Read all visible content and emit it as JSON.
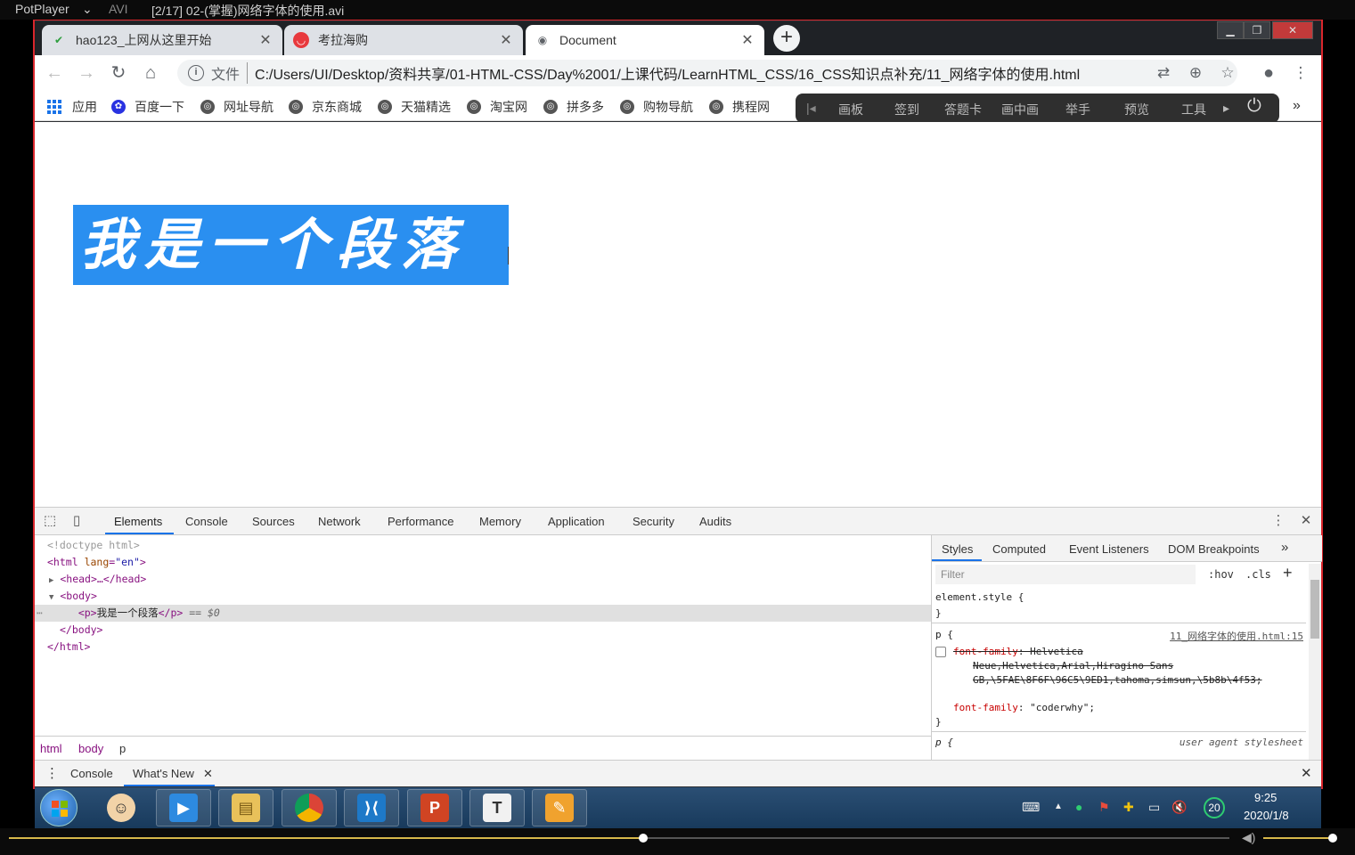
{
  "player": {
    "app": "PotPlayer",
    "format": "AVI",
    "title": "[2/17] 02-(掌握)网络字体的使用.avi",
    "seek_progress": 0.52,
    "volume": 0.95
  },
  "tabs": [
    {
      "label": "hao123_上网从这里开始",
      "icon": "hao123-icon"
    },
    {
      "label": "考拉海购",
      "icon": "kaola-icon"
    },
    {
      "label": "Document",
      "icon": "globe-icon",
      "active": true
    }
  ],
  "toolbar": {
    "file_label": "文件",
    "url": "C:/Users/UI/Desktop/资料共享/01-HTML-CSS/Day%2001/上课代码/LearnHTML_CSS/16_CSS知识点补充/11_网络字体的使用.html"
  },
  "bookmarks": [
    "应用",
    "百度一下",
    "网址导航",
    "京东商城",
    "天猫精选",
    "淘宝网",
    "拼多多",
    "购物导航",
    "携程网"
  ],
  "floatbar": [
    "画板",
    "签到",
    "答题卡",
    "画中画",
    "举手",
    "预览",
    "工具"
  ],
  "page": {
    "paragraph": "我是一个段落"
  },
  "devtools": {
    "tabs": [
      "Elements",
      "Console",
      "Sources",
      "Network",
      "Performance",
      "Memory",
      "Application",
      "Security",
      "Audits"
    ],
    "dom": {
      "doctype": "<!doctype html>",
      "html_open": "<html",
      "html_attr": "lang",
      "html_attr_val": "\"en\"",
      "head": "<head>…</head>",
      "body_open": "<body>",
      "p_open": "<p>",
      "p_text": "我是一个段落",
      "p_close": "</p>",
      "p_marker": "== $0",
      "body_close": "</body>",
      "html_close": "</html>"
    },
    "breadcrumbs": [
      "html",
      "body",
      "p"
    ],
    "styles": {
      "tabs": [
        "Styles",
        "Computed",
        "Event Listeners",
        "DOM Breakpoints"
      ],
      "filter_placeholder": "Filter",
      "hov": ":hov",
      "cls": ".cls",
      "element_style": "element.style {",
      "close_brace": "}",
      "rule1_selector": "p {",
      "rule1_source": "11_网络字体的使用.html:15",
      "rule1_prop1_name": "font-family",
      "rule1_prop1_val_a": ": Helvetica",
      "rule1_prop1_val_b": "Neue,Helvetica,Arial,Hiragino Sans",
      "rule1_prop1_val_c": "GB,\\5FAE\\8F6F\\96C5\\9ED1,tahoma,simsun,\\5b8b\\4f53;",
      "rule1_prop2_name": "font-family",
      "rule1_prop2_val": ": \"coderwhy\";",
      "rule2_selector": "p {",
      "rule2_source": "user agent stylesheet"
    }
  },
  "drawer": {
    "tabs": [
      "Console",
      "What's New"
    ]
  },
  "taskbar": {
    "apps": [
      "avatar-app",
      "thunder-app",
      "file-explorer",
      "chrome",
      "vscode",
      "powerpoint",
      "typora",
      "notepad"
    ],
    "badge": "20",
    "time": "9:25",
    "date": "2020/1/8"
  }
}
